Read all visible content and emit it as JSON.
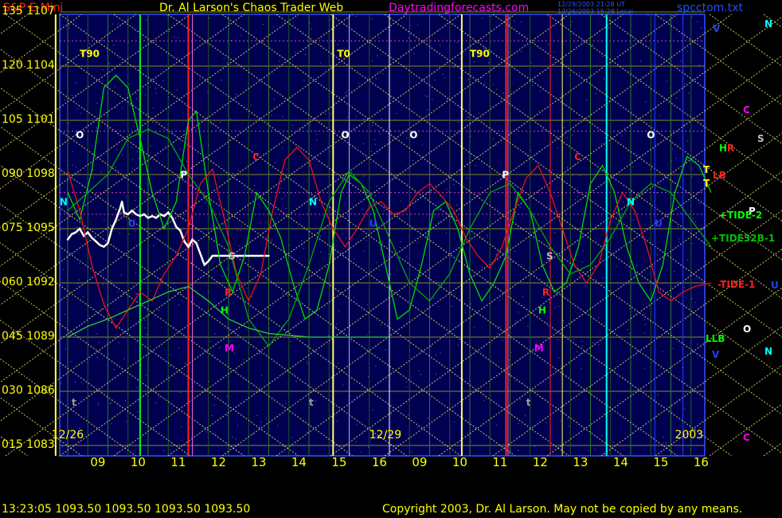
{
  "header": {
    "instrument": "S&P E-Mini",
    "title": "Dr. Al Larson's Chaos Trader Web",
    "site": "Daytradingforecasts.com",
    "stamp_line1": "12/29/2003 21:28 UT",
    "stamp_line2": "12/26/2003 15:28 Local",
    "filename": "spcctom.txt"
  },
  "footer": {
    "quote": "13:23:05  1093.50  1093.50  1093.50  1093.50",
    "copyright": "Copyright 2003, Dr. Al Larson. May not be copied by any means."
  },
  "chart_data": {
    "type": "line",
    "y_tick_labels": [
      {
        "angle": "135",
        "price": "1107"
      },
      {
        "angle": "120",
        "price": "1104"
      },
      {
        "angle": "105",
        "price": "1101"
      },
      {
        "angle": "090",
        "price": "1098"
      },
      {
        "angle": "075",
        "price": "1095"
      },
      {
        "angle": "060",
        "price": "1092"
      },
      {
        "angle": "045",
        "price": "1089"
      },
      {
        "angle": "030",
        "price": "1086"
      },
      {
        "angle": "015",
        "price": "1083"
      }
    ],
    "ylim": [
      1083,
      1107
    ],
    "x_tick_labels": [
      "09",
      "10",
      "11",
      "12",
      "13",
      "14",
      "15",
      "16",
      "09",
      "10",
      "11",
      "12",
      "13",
      "14",
      "15",
      "16"
    ],
    "date_labels": [
      "12/26",
      "12/29",
      "2003"
    ],
    "markers": [
      {
        "text": "T90",
        "color": "#ffff00"
      },
      {
        "text": "T0",
        "color": "#ffff00"
      },
      {
        "text": "T90",
        "color": "#ffff00"
      },
      {
        "text": "O",
        "color": "#ffffff"
      },
      {
        "text": "O",
        "color": "#ffffff"
      },
      {
        "text": "O",
        "color": "#ffffff"
      },
      {
        "text": "O",
        "color": "#ffffff"
      },
      {
        "text": "N",
        "color": "#00ffff"
      },
      {
        "text": "N",
        "color": "#00ffff"
      },
      {
        "text": "N",
        "color": "#00ffff"
      },
      {
        "text": "P",
        "color": "#ffffff"
      },
      {
        "text": "P",
        "color": "#ffffff"
      },
      {
        "text": "C",
        "color": "#ff2020"
      },
      {
        "text": "C",
        "color": "#ff2020"
      },
      {
        "text": "U",
        "color": "#2040ff"
      },
      {
        "text": "U",
        "color": "#2040ff"
      },
      {
        "text": "U",
        "color": "#2040ff"
      },
      {
        "text": "S",
        "color": "#c0c0c0"
      },
      {
        "text": "S",
        "color": "#c0c0c0"
      },
      {
        "text": "R",
        "color": "#ff2020"
      },
      {
        "text": "R",
        "color": "#ff2020"
      },
      {
        "text": "H",
        "color": "#00ff00"
      },
      {
        "text": "H",
        "color": "#00ff00"
      },
      {
        "text": "M",
        "color": "#ff00ff"
      },
      {
        "text": "M",
        "color": "#ff00ff"
      },
      {
        "text": "t",
        "color": "#a0a0a0"
      },
      {
        "text": "t",
        "color": "#a0a0a0"
      },
      {
        "text": "t",
        "color": "#a0a0a0"
      }
    ],
    "right_legend": [
      {
        "text": "V",
        "color": "#2040ff"
      },
      {
        "text": "N",
        "color": "#00ffff"
      },
      {
        "text": "C",
        "color": "#ff00ff"
      },
      {
        "text": "H",
        "color": "#00ff00"
      },
      {
        "text": "R",
        "color": "#ff2020"
      },
      {
        "text": "S",
        "color": "#c0c0c0"
      },
      {
        "text": "T",
        "color": "#ffff00"
      },
      {
        "text": "LB",
        "color": "#ff2020"
      },
      {
        "text": "T",
        "color": "#ffff00"
      },
      {
        "text": "P",
        "color": "#ffffff"
      },
      {
        "text": "+TIDE-2",
        "color": "#00ff00"
      },
      {
        "text": "+TIDE32B-1",
        "color": "#00c000"
      },
      {
        "text": "-TIDE-1",
        "color": "#ff2020"
      },
      {
        "text": "U",
        "color": "#2040ff"
      },
      {
        "text": "LLB",
        "color": "#00ff00"
      },
      {
        "text": "O",
        "color": "#ffffff"
      },
      {
        "text": "V",
        "color": "#2040ff"
      },
      {
        "text": "N",
        "color": "#00ffff"
      },
      {
        "text": "C",
        "color": "#ff00ff"
      }
    ],
    "series": [
      {
        "name": "price",
        "color": "#ffffff",
        "points": [
          [
            0.0,
            1094.4
          ],
          [
            0.1,
            1094.7
          ],
          [
            0.2,
            1094.8
          ],
          [
            0.3,
            1095.0
          ],
          [
            0.4,
            1094.6
          ],
          [
            0.5,
            1094.8
          ],
          [
            0.6,
            1094.5
          ],
          [
            0.7,
            1094.3
          ],
          [
            0.8,
            1094.1
          ],
          [
            0.9,
            1094.0
          ],
          [
            1.0,
            1094.2
          ],
          [
            1.1,
            1095.0
          ],
          [
            1.2,
            1095.5
          ],
          [
            1.3,
            1096.1
          ],
          [
            1.35,
            1096.5
          ],
          [
            1.4,
            1095.9
          ],
          [
            1.5,
            1095.8
          ],
          [
            1.6,
            1096.0
          ],
          [
            1.7,
            1095.8
          ],
          [
            1.8,
            1095.7
          ],
          [
            1.9,
            1095.8
          ],
          [
            2.0,
            1095.6
          ],
          [
            2.1,
            1095.7
          ],
          [
            2.2,
            1095.6
          ],
          [
            2.3,
            1095.8
          ],
          [
            2.4,
            1095.7
          ],
          [
            2.5,
            1095.9
          ],
          [
            2.6,
            1095.6
          ],
          [
            2.7,
            1095.1
          ],
          [
            2.8,
            1094.9
          ],
          [
            2.9,
            1094.3
          ],
          [
            3.0,
            1094.0
          ],
          [
            3.1,
            1094.4
          ],
          [
            3.2,
            1094.2
          ],
          [
            3.3,
            1093.6
          ],
          [
            3.4,
            1093.0
          ],
          [
            3.5,
            1093.2
          ],
          [
            3.6,
            1093.5
          ],
          [
            3.7,
            1093.5
          ],
          [
            4.0,
            1093.5
          ],
          [
            5.0,
            1093.5
          ]
        ]
      },
      {
        "name": "",
        "color": "#00dd00",
        "points": [
          [
            0.0,
            1097.0
          ],
          [
            0.3,
            1095.5
          ],
          [
            0.6,
            1098.2
          ],
          [
            0.9,
            1102.8
          ],
          [
            1.2,
            1103.5
          ],
          [
            1.5,
            1102.8
          ],
          [
            1.8,
            1100.0
          ],
          [
            2.1,
            1097.0
          ],
          [
            2.4,
            1095.0
          ],
          [
            2.7,
            1096.5
          ],
          [
            3.0,
            1101.0
          ],
          [
            3.2,
            1101.5
          ],
          [
            3.5,
            1097.0
          ],
          [
            3.8,
            1093.0
          ],
          [
            4.1,
            1091.5
          ],
          [
            4.4,
            1093.5
          ],
          [
            4.7,
            1097.0
          ],
          [
            5.0,
            1096.0
          ],
          [
            5.3,
            1094.5
          ],
          [
            5.6,
            1092.0
          ],
          [
            5.9,
            1090.0
          ],
          [
            6.2,
            1090.5
          ],
          [
            6.5,
            1093.0
          ],
          [
            6.8,
            1097.0
          ],
          [
            7.0,
            1098.0
          ],
          [
            7.3,
            1097.5
          ],
          [
            7.6,
            1096.0
          ],
          [
            7.9,
            1093.0
          ],
          [
            8.2,
            1090.0
          ],
          [
            8.5,
            1090.5
          ],
          [
            8.8,
            1093.0
          ],
          [
            9.1,
            1096.0
          ],
          [
            9.4,
            1096.5
          ],
          [
            9.7,
            1095.0
          ],
          [
            10.0,
            1092.5
          ],
          [
            10.3,
            1091.0
          ],
          [
            10.6,
            1092.0
          ],
          [
            10.9,
            1093.5
          ],
          [
            11.2,
            1097.0
          ],
          [
            11.5,
            1096.0
          ],
          [
            11.8,
            1093.0
          ],
          [
            12.1,
            1091.5
          ],
          [
            12.4,
            1092.0
          ],
          [
            12.7,
            1094.0
          ],
          [
            13.0,
            1097.5
          ],
          [
            13.3,
            1098.5
          ],
          [
            13.6,
            1097.0
          ],
          [
            13.9,
            1094.0
          ],
          [
            14.2,
            1092.0
          ],
          [
            14.5,
            1091.0
          ],
          [
            14.8,
            1093.0
          ],
          [
            15.1,
            1097.0
          ],
          [
            15.4,
            1099.0
          ],
          [
            15.7,
            1098.5
          ],
          [
            16.0,
            1097.0
          ]
        ]
      },
      {
        "name": "",
        "color": "#ee1111",
        "points": [
          [
            0.0,
            1098.2
          ],
          [
            0.3,
            1096.0
          ],
          [
            0.6,
            1093.0
          ],
          [
            0.9,
            1090.8
          ],
          [
            1.2,
            1089.5
          ],
          [
            1.5,
            1090.5
          ],
          [
            1.8,
            1091.5
          ],
          [
            2.1,
            1091.0
          ],
          [
            2.4,
            1092.5
          ],
          [
            2.7,
            1093.5
          ],
          [
            3.0,
            1095.0
          ],
          [
            3.3,
            1097.5
          ],
          [
            3.6,
            1098.3
          ],
          [
            3.9,
            1095.5
          ],
          [
            4.2,
            1092.5
          ],
          [
            4.5,
            1091.0
          ],
          [
            4.8,
            1092.5
          ],
          [
            5.1,
            1096.0
          ],
          [
            5.4,
            1098.8
          ],
          [
            5.7,
            1099.5
          ],
          [
            6.0,
            1098.8
          ],
          [
            6.3,
            1096.5
          ],
          [
            6.6,
            1095.0
          ],
          [
            6.9,
            1094.0
          ],
          [
            7.2,
            1095.0
          ],
          [
            7.5,
            1096.2
          ],
          [
            7.8,
            1096.5
          ],
          [
            8.1,
            1095.8
          ],
          [
            8.4,
            1096.0
          ],
          [
            8.7,
            1097.0
          ],
          [
            9.0,
            1097.5
          ],
          [
            9.3,
            1096.8
          ],
          [
            9.6,
            1096.0
          ],
          [
            9.9,
            1094.5
          ],
          [
            10.2,
            1093.5
          ],
          [
            10.5,
            1092.8
          ],
          [
            10.8,
            1094.0
          ],
          [
            11.1,
            1096.0
          ],
          [
            11.4,
            1097.8
          ],
          [
            11.7,
            1098.5
          ],
          [
            12.0,
            1097.0
          ],
          [
            12.3,
            1095.0
          ],
          [
            12.6,
            1093.0
          ],
          [
            12.9,
            1092.0
          ],
          [
            13.2,
            1093.0
          ],
          [
            13.5,
            1095.5
          ],
          [
            13.8,
            1097.0
          ],
          [
            14.1,
            1096.0
          ],
          [
            14.4,
            1094.0
          ],
          [
            14.7,
            1091.5
          ],
          [
            15.0,
            1091.0
          ],
          [
            15.3,
            1091.5
          ],
          [
            15.6,
            1091.8
          ],
          [
            16.0,
            1092.0
          ]
        ]
      },
      {
        "name": "",
        "color": "#00aa00",
        "points": [
          [
            0.0,
            1096.0
          ],
          [
            0.5,
            1097.0
          ],
          [
            1.0,
            1098.0
          ],
          [
            1.5,
            1100.0
          ],
          [
            2.0,
            1100.5
          ],
          [
            2.5,
            1100.0
          ],
          [
            3.0,
            1098.0
          ],
          [
            3.5,
            1096.5
          ],
          [
            4.0,
            1094.0
          ],
          [
            4.5,
            1090.0
          ],
          [
            5.0,
            1088.5
          ],
          [
            5.5,
            1090.0
          ],
          [
            6.0,
            1093.0
          ],
          [
            6.5,
            1096.5
          ],
          [
            7.0,
            1098.2
          ],
          [
            7.5,
            1097.0
          ],
          [
            8.0,
            1094.5
          ],
          [
            8.5,
            1092.0
          ],
          [
            9.0,
            1091.0
          ],
          [
            9.5,
            1092.5
          ],
          [
            10.0,
            1095.0
          ],
          [
            10.5,
            1097.0
          ],
          [
            11.0,
            1097.5
          ],
          [
            11.5,
            1096.0
          ],
          [
            12.0,
            1094.0
          ],
          [
            12.5,
            1092.5
          ],
          [
            13.0,
            1093.0
          ],
          [
            13.5,
            1094.5
          ],
          [
            14.0,
            1096.5
          ],
          [
            14.5,
            1097.5
          ],
          [
            15.0,
            1097.0
          ],
          [
            15.5,
            1095.5
          ],
          [
            16.0,
            1094.0
          ]
        ]
      },
      {
        "name": "",
        "color": "#33cc33",
        "points": [
          [
            0.0,
            1089.0
          ],
          [
            0.5,
            1089.6
          ],
          [
            1.0,
            1090.0
          ],
          [
            1.5,
            1090.5
          ],
          [
            2.0,
            1091.0
          ],
          [
            2.5,
            1091.5
          ],
          [
            3.0,
            1091.8
          ],
          [
            3.5,
            1091.0
          ],
          [
            4.0,
            1090.0
          ],
          [
            4.5,
            1089.5
          ],
          [
            5.0,
            1089.2
          ],
          [
            5.5,
            1089.1
          ],
          [
            6.0,
            1089.0
          ],
          [
            7.0,
            1089.0
          ],
          [
            8.0,
            1089.0
          ]
        ]
      }
    ]
  }
}
